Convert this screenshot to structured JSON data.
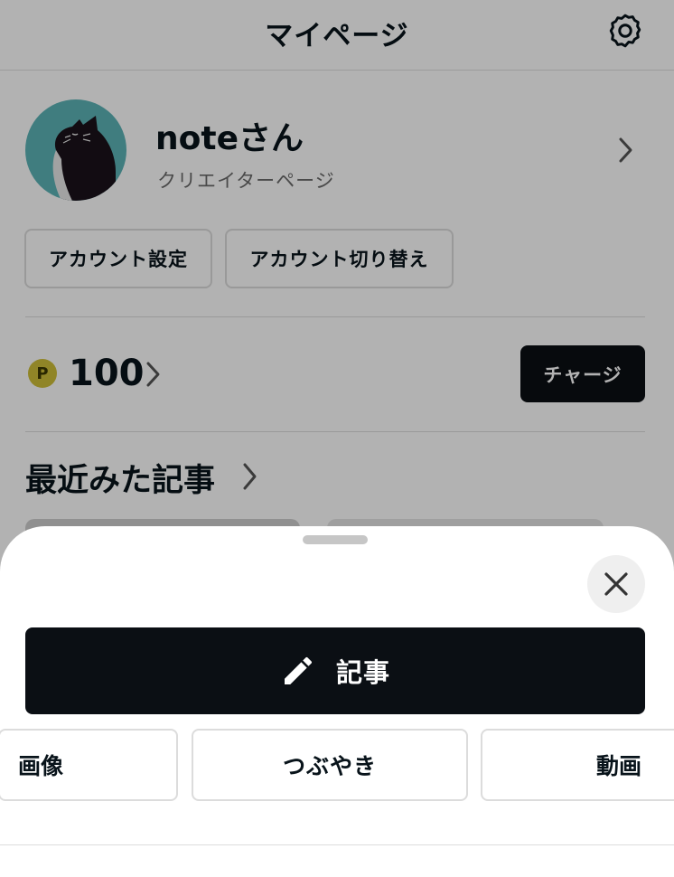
{
  "header": {
    "title": "マイページ"
  },
  "profile": {
    "name": "noteさん",
    "creator_link": "クリエイターページ"
  },
  "account_buttons": {
    "settings": "アカウント設定",
    "switch": "アカウント切り替え"
  },
  "points": {
    "icon_letter": "P",
    "value": "100",
    "charge_label": "チャージ"
  },
  "recent": {
    "title": "最近みた記事"
  },
  "sheet": {
    "article_label": "記事",
    "options": [
      "画像",
      "つぶやき",
      "動画"
    ]
  },
  "colors": {
    "accent_dark": "#0b0f14",
    "avatar_bg": "#5cb3b6",
    "coin": "#cfbf38"
  }
}
